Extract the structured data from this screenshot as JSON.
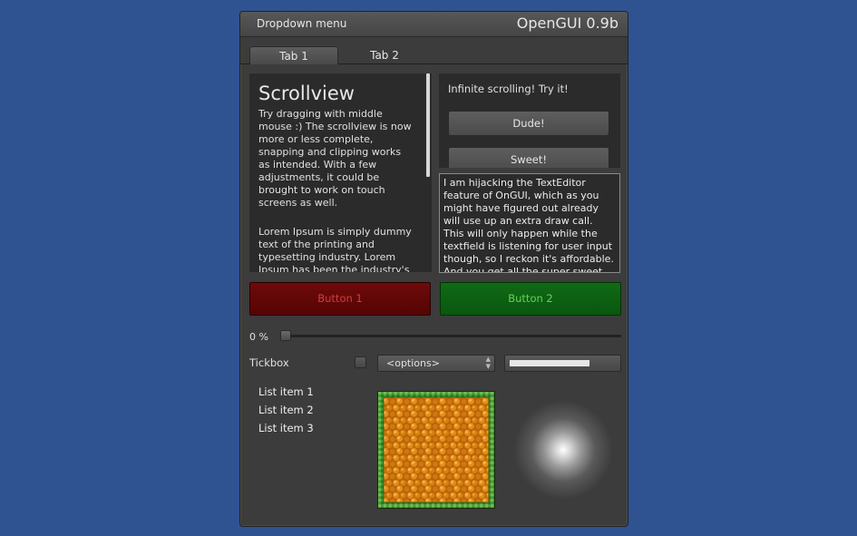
{
  "window": {
    "menu_label": "Dropdown menu",
    "app_title": "OpenGUI 0.9b"
  },
  "tabs": [
    {
      "label": "Tab 1",
      "active": true
    },
    {
      "label": "Tab 2",
      "active": false
    }
  ],
  "scrollview": {
    "title": "Scrollview",
    "paragraph1": "Try dragging with middle mouse :) The scrollview is now more or less complete, snapping and clipping works as intended. With a few adjustments, it could be brought to work on touch screens as well.",
    "paragraph2": "Lorem Ipsum is simply dummy text of the printing and typesetting industry. Lorem Ipsum has been the industry's"
  },
  "infinite_scroll": {
    "label": "Infinite scrolling! Try it!",
    "buttons": [
      "Dude!",
      "Sweet!"
    ]
  },
  "text_editor": {
    "text": "I am hijacking the TextEditor feature of OnGUI, which as you might have figured out already will use up an extra draw call. This will only happen while the textfield is listening for user input though, so I reckon it's affordable. And you get all the super sweet clipboard"
  },
  "buttons": {
    "button1": "Button 1",
    "button2": "Button 2",
    "button1_color": "#d43c3c",
    "button2_color": "#63d25a"
  },
  "progress": {
    "label": "0 %",
    "value": 0
  },
  "controls": {
    "tickbox_label": "Tickbox",
    "tickbox_checked": false,
    "dropdown_value": "<options>",
    "bar_fill_fraction": 0.75
  },
  "list": {
    "items": [
      "List item 1",
      "List item 2",
      "List item 3"
    ]
  },
  "colors": {
    "background": "#2f5291",
    "panel": "#3c3c3c",
    "dark_panel": "#2b2b2b"
  }
}
